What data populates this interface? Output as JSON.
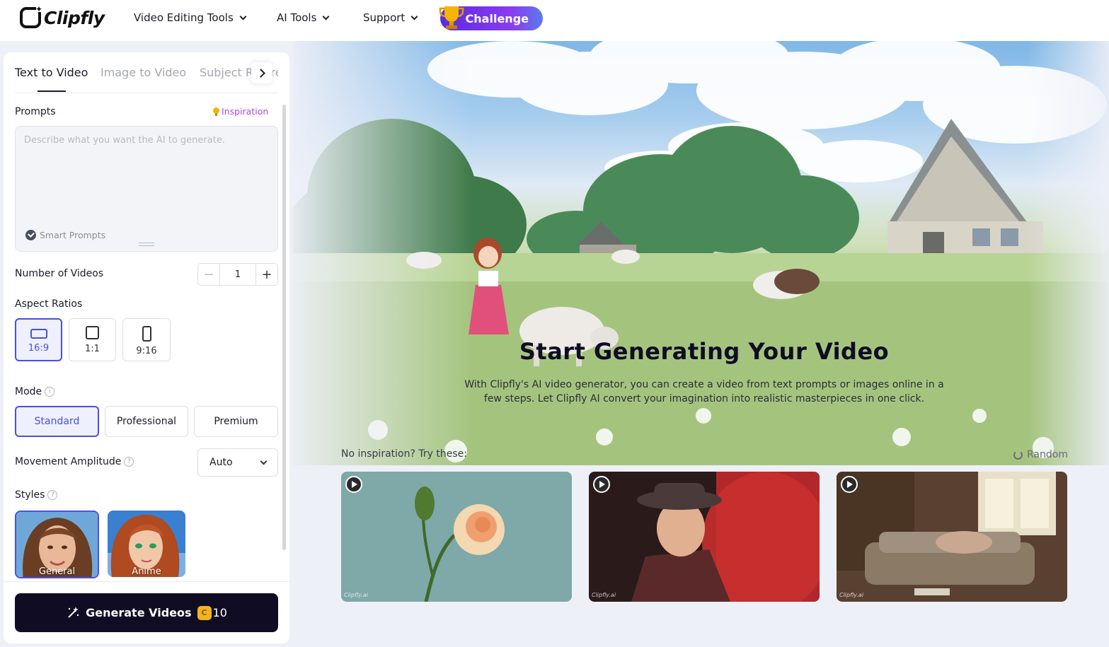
{
  "header": {
    "logo": "Clipfly",
    "nav": [
      "Video Editing Tools",
      "AI Tools",
      "Support"
    ],
    "challenge": "Challenge"
  },
  "panel": {
    "tabs": [
      "Text to Video",
      "Image to Video",
      "Subject Reference"
    ],
    "prompts_label": "Prompts",
    "inspiration": "Inspiration",
    "prompt_placeholder": "Describe what you want the AI to generate.",
    "smart_prompts": "Smart Prompts",
    "num_videos_label": "Number of Videos",
    "num_videos_value": "1",
    "aspect_label": "Aspect Ratios",
    "aspect_ratios": [
      "16:9",
      "1:1",
      "9:16"
    ],
    "mode_label": "Mode",
    "modes": [
      "Standard",
      "Professional",
      "Premium"
    ],
    "movement_label": "Movement Amplitude",
    "movement_value": "Auto",
    "styles_label": "Styles",
    "styles": [
      "General",
      "Anime"
    ],
    "generate_label": "Generate Videos",
    "credits": "10"
  },
  "hero": {
    "title": "Start Generating Your Video",
    "subtitle": "With Clipfly's AI video generator, you can create a video from text prompts or images online in a few steps. Let Clipfly AI convert your imagination into realistic masterpieces in one click.",
    "try_label": "No inspiration? Try these:",
    "random": "Random",
    "watermark": "Clipfly.ai"
  },
  "colors": {
    "accent": "#4b4ee6",
    "dark_button": "#0f0c24",
    "inspiration": "#a44ce0"
  }
}
